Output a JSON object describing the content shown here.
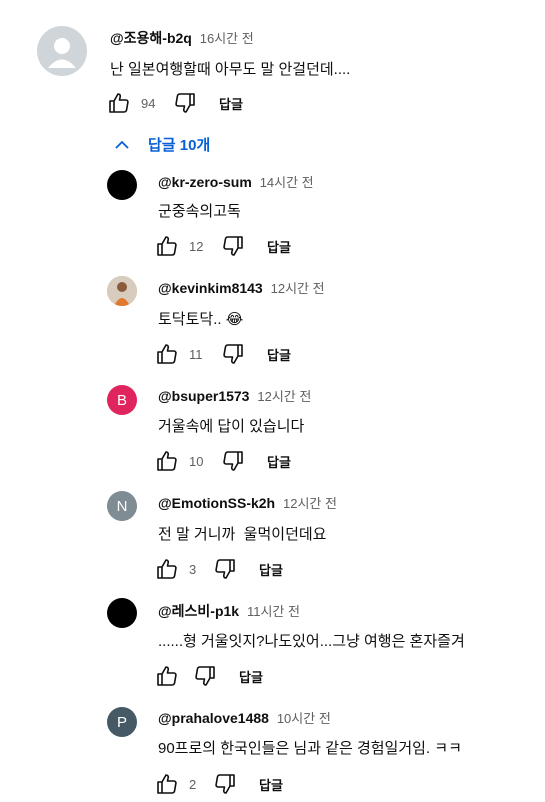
{
  "main_comment": {
    "author": "@조용해-b2q",
    "time": "16시간 전",
    "text": "난 일본여행할때 아무도 말 안걸던데....",
    "likes": "94",
    "reply_label": "답글"
  },
  "replies_toggle": {
    "label": "답글 10개"
  },
  "replies": [
    {
      "author": "@kr-zero-sum",
      "time": "14시간 전",
      "text": "군중속의고독",
      "likes": "12",
      "reply_label": "답글",
      "avatar_letter": "",
      "avatar_color": "#000000"
    },
    {
      "author": "@kevinkim8143",
      "time": "12시간 전",
      "text": "토닥토닥..",
      "emoji": "😂",
      "likes": "11",
      "reply_label": "답글",
      "avatar_letter": "",
      "avatar_color": "#c9b8a6"
    },
    {
      "author": "@bsuper1573",
      "time": "12시간 전",
      "text": "거울속에 답이 있습니다",
      "likes": "10",
      "reply_label": "답글",
      "avatar_letter": "B",
      "avatar_color": "#e0245e"
    },
    {
      "author": "@EmotionSS-k2h",
      "time": "12시간 전",
      "text": "전 말 거니까  울먹이던데요",
      "likes": "3",
      "reply_label": "답글",
      "avatar_letter": "N",
      "avatar_color": "#7f8c93"
    },
    {
      "author": "@레스비-p1k",
      "time": "11시간 전",
      "text": "......형 거울잇지?나도있어...그냥 여행은 혼자즐겨",
      "likes": "",
      "reply_label": "답글",
      "avatar_letter": "",
      "avatar_color": "#000000"
    },
    {
      "author": "@prahalove1488",
      "time": "10시간 전",
      "text": "90프로의 한국인들은 님과 같은 경험일거임. ㅋㅋ",
      "likes": "2",
      "reply_label": "답글",
      "avatar_letter": "P",
      "avatar_color": "#455a64"
    }
  ],
  "icons": {
    "like": "thumbs-up-icon",
    "dislike": "thumbs-down-icon",
    "chevron": "chevron-up-icon"
  },
  "colors": {
    "link_blue": "#065fd4",
    "meta_gray": "#606060"
  }
}
